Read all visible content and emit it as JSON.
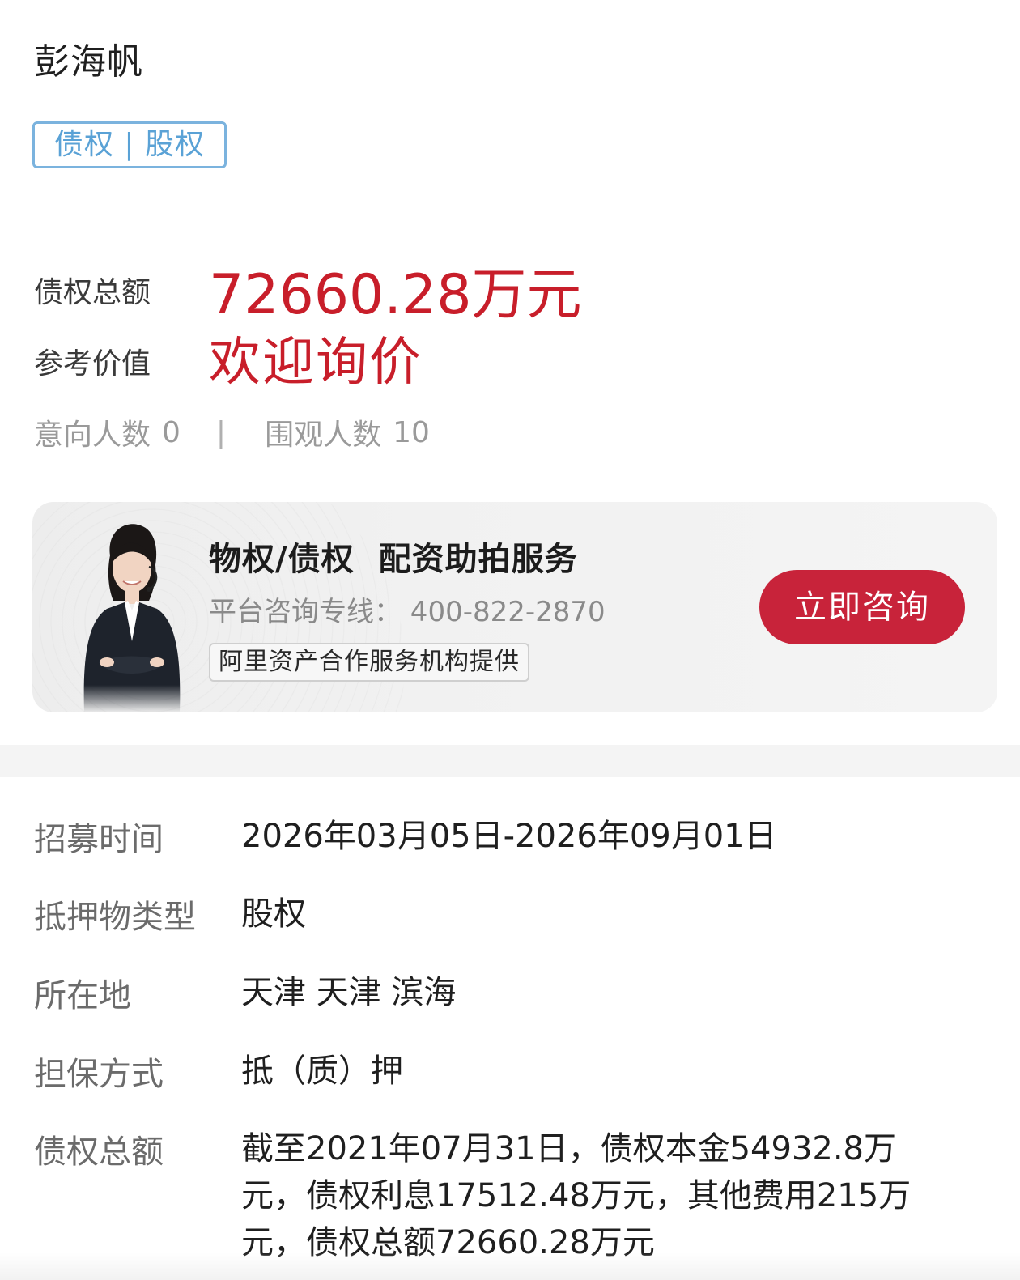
{
  "header": {
    "title": "彭海帆",
    "tag": "债权 | 股权"
  },
  "summary": {
    "amount_label": "债权总额",
    "amount_value": "72660.28万元",
    "ref_label": "参考价值",
    "ref_value": "欢迎询价",
    "intent_label": "意向人数",
    "intent_count": "0",
    "separator": "|",
    "view_label": "围观人数",
    "view_count": "10"
  },
  "service_card": {
    "title_part1": "物权/债权",
    "title_part2": "配资助拍服务",
    "hotline": "平台咨询专线： 400-822-2870",
    "provider": "阿里资产合作服务机构提供",
    "button_label": "立即咨询",
    "avatar_icon": "customer-service-agent-avatar"
  },
  "details": [
    {
      "label": "招募时间",
      "value": "2026年03月05日-2026年09月01日"
    },
    {
      "label": "抵押物类型",
      "value": "股权"
    },
    {
      "label": "所在地",
      "value": "天津 天津 滨海"
    },
    {
      "label": "担保方式",
      "value": "抵（质）押"
    },
    {
      "label": "债权总额",
      "value": "截至2021年07月31日，债权本金54932.8万元，债权利息17512.48万元，其他费用215万元，债权总额72660.28万元"
    }
  ],
  "colors": {
    "accent_red": "#c81e2a",
    "button_red": "#c8233a",
    "tag_blue": "#5aa2d6"
  }
}
